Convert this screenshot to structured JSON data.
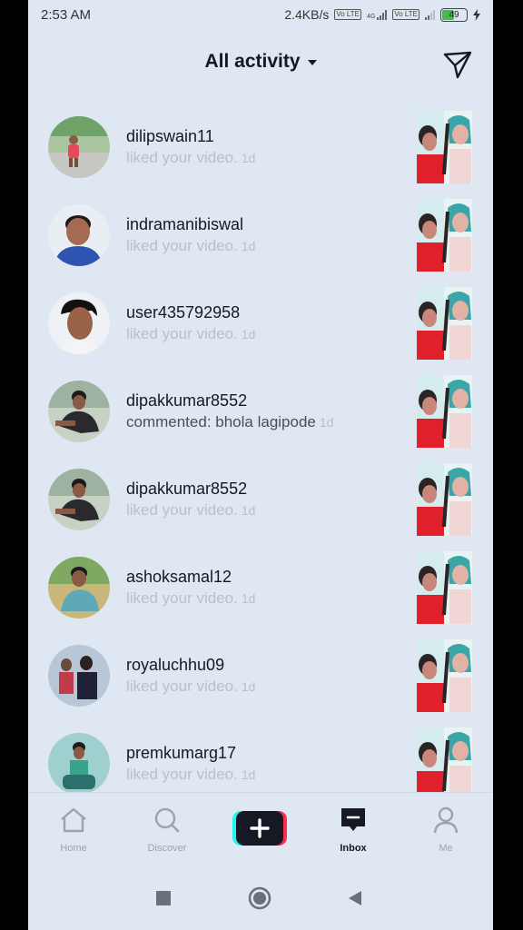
{
  "status_bar": {
    "time": "2:53 AM",
    "net_speed": "2.4KB/s",
    "volte_1": "Vo LTE",
    "volte_2": "Vo LTE",
    "network_4g": "4G",
    "battery": "49"
  },
  "header": {
    "title": "All activity"
  },
  "activities": [
    {
      "username": "dilipswain11",
      "text": "liked your video.",
      "time": "1d",
      "type": "like"
    },
    {
      "username": "indramanibiswal",
      "text": "liked your video.",
      "time": "1d",
      "type": "like"
    },
    {
      "username": "user435792958",
      "text": "liked your video.",
      "time": "1d",
      "type": "like"
    },
    {
      "username": "dipakkumar8552",
      "text": "commented: bhola lagipode",
      "time": "1d",
      "type": "comment"
    },
    {
      "username": "dipakkumar8552",
      "text": "liked your video.",
      "time": "1d",
      "type": "like"
    },
    {
      "username": "ashoksamal12",
      "text": "liked your video.",
      "time": "1d",
      "type": "like"
    },
    {
      "username": "royaluchhu09",
      "text": "liked your video.",
      "time": "1d",
      "type": "like"
    },
    {
      "username": "premkumarg17",
      "text": "liked your video.",
      "time": "1d",
      "type": "like"
    }
  ],
  "bottom_nav": {
    "home": "Home",
    "discover": "Discover",
    "inbox": "Inbox",
    "me": "Me"
  },
  "colors": {
    "text_primary": "#161823",
    "text_muted": "#b8c0ca",
    "background": "#dfe8f2",
    "accent_red": "#fe2c55",
    "accent_cyan": "#25f4ee"
  }
}
